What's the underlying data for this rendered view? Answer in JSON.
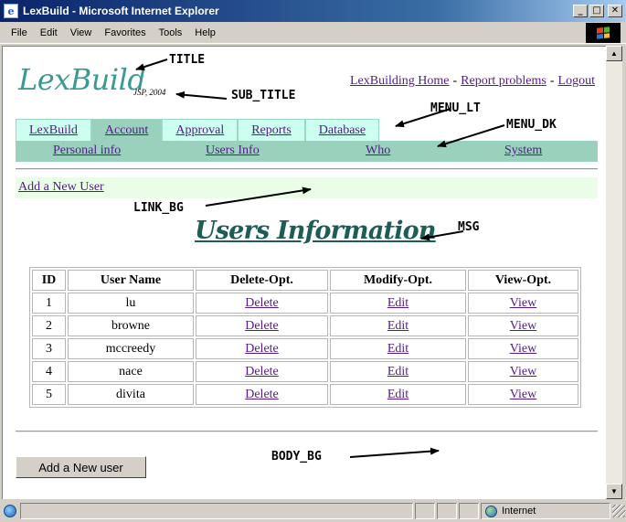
{
  "window": {
    "title": "LexBuild - Microsoft Internet Explorer",
    "controls": {
      "minimize": "_",
      "maximize": "□",
      "close": "✕"
    }
  },
  "browser_menu": [
    "File",
    "Edit",
    "View",
    "Favorites",
    "Tools",
    "Help"
  ],
  "page": {
    "title": "LexBuild",
    "subtitle": "JSP, 2004",
    "top_links": [
      "LexBuilding Home",
      "Report problems",
      "Logout"
    ],
    "top_link_separator": "-",
    "menu_lt": [
      {
        "label": "LexBuild",
        "active": false
      },
      {
        "label": "Account",
        "active": true
      },
      {
        "label": "Approval",
        "active": false
      },
      {
        "label": "Reports",
        "active": false
      },
      {
        "label": "Database",
        "active": false
      }
    ],
    "menu_dk": [
      "Personal info",
      "Users Info",
      "Who",
      "System"
    ],
    "link_bg_text": "Add a New User",
    "msg": "Users Information",
    "table": {
      "headers": [
        "ID",
        "User Name",
        "Delete-Opt.",
        "Modify-Opt.",
        "View-Opt."
      ],
      "rows": [
        {
          "id": "1",
          "name": "lu",
          "delete": "Delete",
          "modify": "Edit",
          "view": "View"
        },
        {
          "id": "2",
          "name": "browne",
          "delete": "Delete",
          "modify": "Edit",
          "view": "View"
        },
        {
          "id": "3",
          "name": "mccreedy",
          "delete": "Delete",
          "modify": "Edit",
          "view": "View"
        },
        {
          "id": "4",
          "name": "nace",
          "delete": "Delete",
          "modify": "Edit",
          "view": "View"
        },
        {
          "id": "5",
          "name": "divita",
          "delete": "Delete",
          "modify": "Edit",
          "view": "View"
        }
      ]
    },
    "add_button_label": "Add a New user"
  },
  "annotations": {
    "title": "TITLE",
    "sub_title": "SUB_TITLE",
    "menu_lt": "MENU_LT",
    "menu_dk": "MENU_DK",
    "link_bg": "LINK_BG",
    "msg": "MSG",
    "body_bg": "BODY_BG"
  },
  "status_bar": {
    "zone": "Internet"
  },
  "colors": {
    "title": "#3a9a93",
    "menu_lt_bg": "#ccfff0",
    "menu_dk_bg": "#99d1bd",
    "link_bg": "#e9fde7",
    "msg": "#1d5c57",
    "visited_link": "#551a8b"
  },
  "icons": {
    "window": "ie-icon",
    "brand": "windows-logo",
    "status_page": "page-icon",
    "zone": "globe-icon"
  }
}
